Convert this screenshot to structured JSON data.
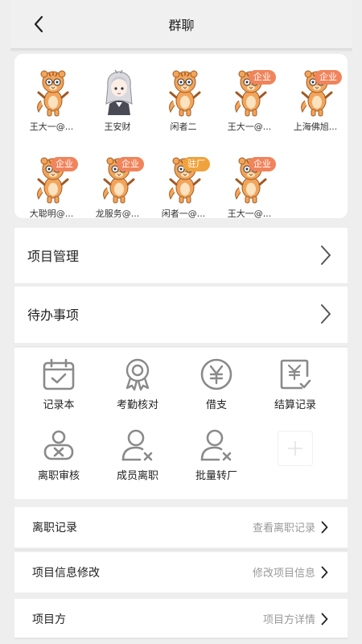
{
  "header": {
    "title": "群聊",
    "back_icon": "back-arrow-icon"
  },
  "members": [
    {
      "name": "王大一@...",
      "avatar": "tiger",
      "badge": ""
    },
    {
      "name": "王安财",
      "avatar": "anime",
      "badge": ""
    },
    {
      "name": "闲者二",
      "avatar": "tiger",
      "badge": ""
    },
    {
      "name": "王大一@...",
      "avatar": "tiger",
      "badge": "企业"
    },
    {
      "name": "上海佛旭...",
      "avatar": "tiger",
      "badge": "企业"
    },
    {
      "name": "大聪明@...",
      "avatar": "tiger",
      "badge": "企业"
    },
    {
      "name": "龙服务@...",
      "avatar": "tiger",
      "badge": "企业"
    },
    {
      "name": "闲者一@...",
      "avatar": "tiger",
      "badge": "驻厂"
    },
    {
      "name": "王大一@...",
      "avatar": "tiger",
      "badge": "企业"
    }
  ],
  "nav": {
    "project_management": "项目管理",
    "todo": "待办事项"
  },
  "tools": [
    {
      "label": "记录本",
      "icon": "calendar-check-icon"
    },
    {
      "label": "考勤核对",
      "icon": "ribbon-badge-icon"
    },
    {
      "label": "借支",
      "icon": "yen-circle-icon"
    },
    {
      "label": "结算记录",
      "icon": "yen-document-icon"
    },
    {
      "label": "离职审核",
      "icon": "user-x-card-icon"
    },
    {
      "label": "成员离职",
      "icon": "user-remove-icon"
    },
    {
      "label": "批量转厂",
      "icon": "user-transfer-icon"
    }
  ],
  "info": {
    "resign_record": {
      "label": "离职记录",
      "value": "查看离职记录"
    },
    "project_edit": {
      "label": "项目信息修改",
      "value": "修改项目信息"
    },
    "project_party": {
      "label": "项目方",
      "value": "项目方详情"
    }
  },
  "colors": {
    "badge": "#f0845b",
    "badge_alt": "#f0a23c",
    "icon_gray": "#8a8a8a"
  }
}
